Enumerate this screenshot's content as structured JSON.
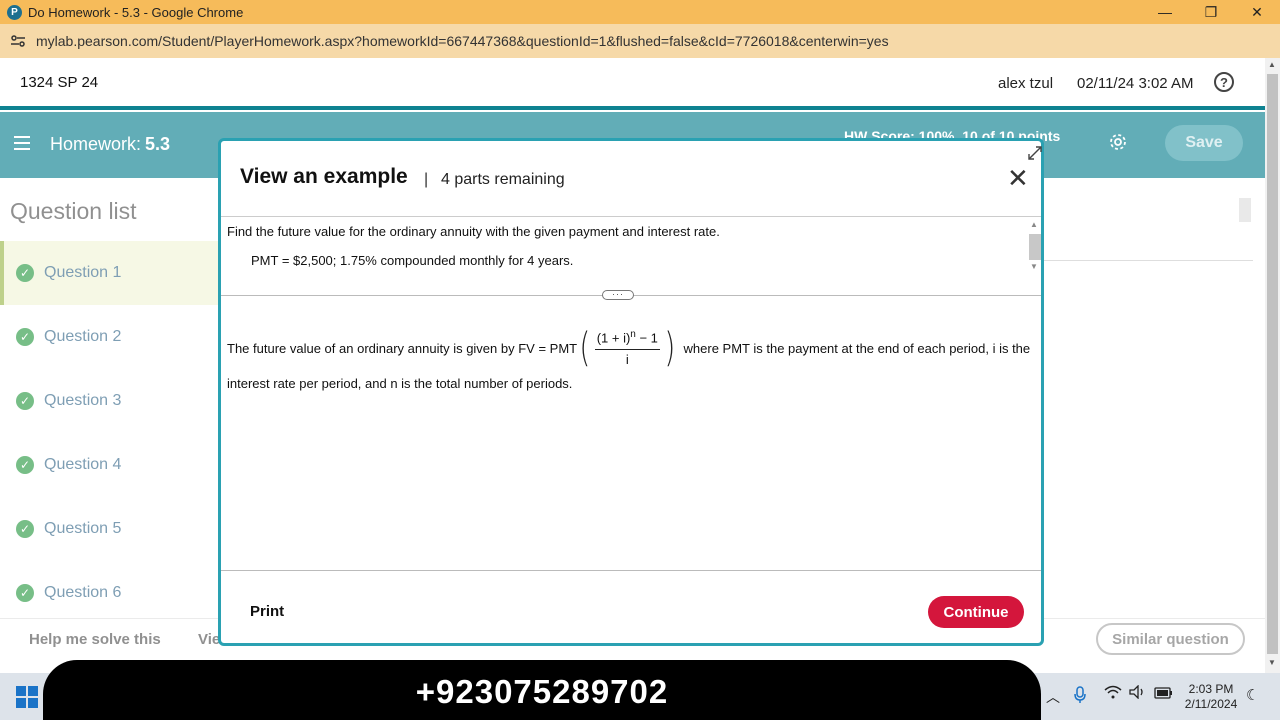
{
  "browser": {
    "window_title": "Do Homework - 5.3 - Google Chrome",
    "url": "mylab.pearson.com/Student/PlayerHomework.aspx?homeworkId=667447368&questionId=1&flushed=false&cId=7726018&centerwin=yes",
    "controls": {
      "minimize": "—",
      "restore": "❐",
      "close": "✕"
    }
  },
  "header": {
    "course": "1324 SP 24",
    "user": "alex tzul",
    "datetime": "02/11/24 3:02 AM",
    "help": "?"
  },
  "homework_bar": {
    "label": "Homework:",
    "number": "5.3",
    "score": "HW Score: 100%, 10 of 10 points",
    "save_label": "Save"
  },
  "question_list": {
    "title": "Question list",
    "items": [
      {
        "label": "Question 1",
        "status": "complete",
        "active": true
      },
      {
        "label": "Question 2",
        "status": "complete",
        "active": false
      },
      {
        "label": "Question 3",
        "status": "complete",
        "active": false
      },
      {
        "label": "Question 4",
        "status": "complete",
        "active": false
      },
      {
        "label": "Question 5",
        "status": "complete",
        "active": false
      },
      {
        "label": "Question 6",
        "status": "complete",
        "active": false
      }
    ]
  },
  "bottom_bar": {
    "help_solve": "Help me solve this",
    "view_example_partial": "Vie",
    "similar_question": "Similar question"
  },
  "modal": {
    "title": "View an example",
    "separator": "|",
    "parts_remaining": "4 parts remaining",
    "close": "✕",
    "problem_line1": "Find the future value for the ordinary annuity with the given payment and interest rate.",
    "problem_line2": "PMT = $2,500; 1.75% compounded monthly for 4 years.",
    "body_prefix": "The future value of an ordinary annuity is given by FV = PMT",
    "formula_numerator": "(1 + i)",
    "formula_exponent": "n",
    "formula_numerator_suffix": " − 1",
    "formula_denominator": "i",
    "body_suffix": "where PMT is the payment at the end of each period, i is the",
    "body_line2": "interest rate per period, and n is the total number of periods.",
    "print_label": "Print",
    "continue_label": "Continue"
  },
  "taskbar": {
    "time": "2:03 PM",
    "date": "2/11/2024"
  },
  "overlay_banner": {
    "text": "+923075289702"
  },
  "colors": {
    "teal": "#0e8291",
    "modal_border": "#2aa1b2",
    "continue": "#d4163c",
    "check_green": "#2e9b47",
    "chrome_title": "#f6bb5a"
  }
}
